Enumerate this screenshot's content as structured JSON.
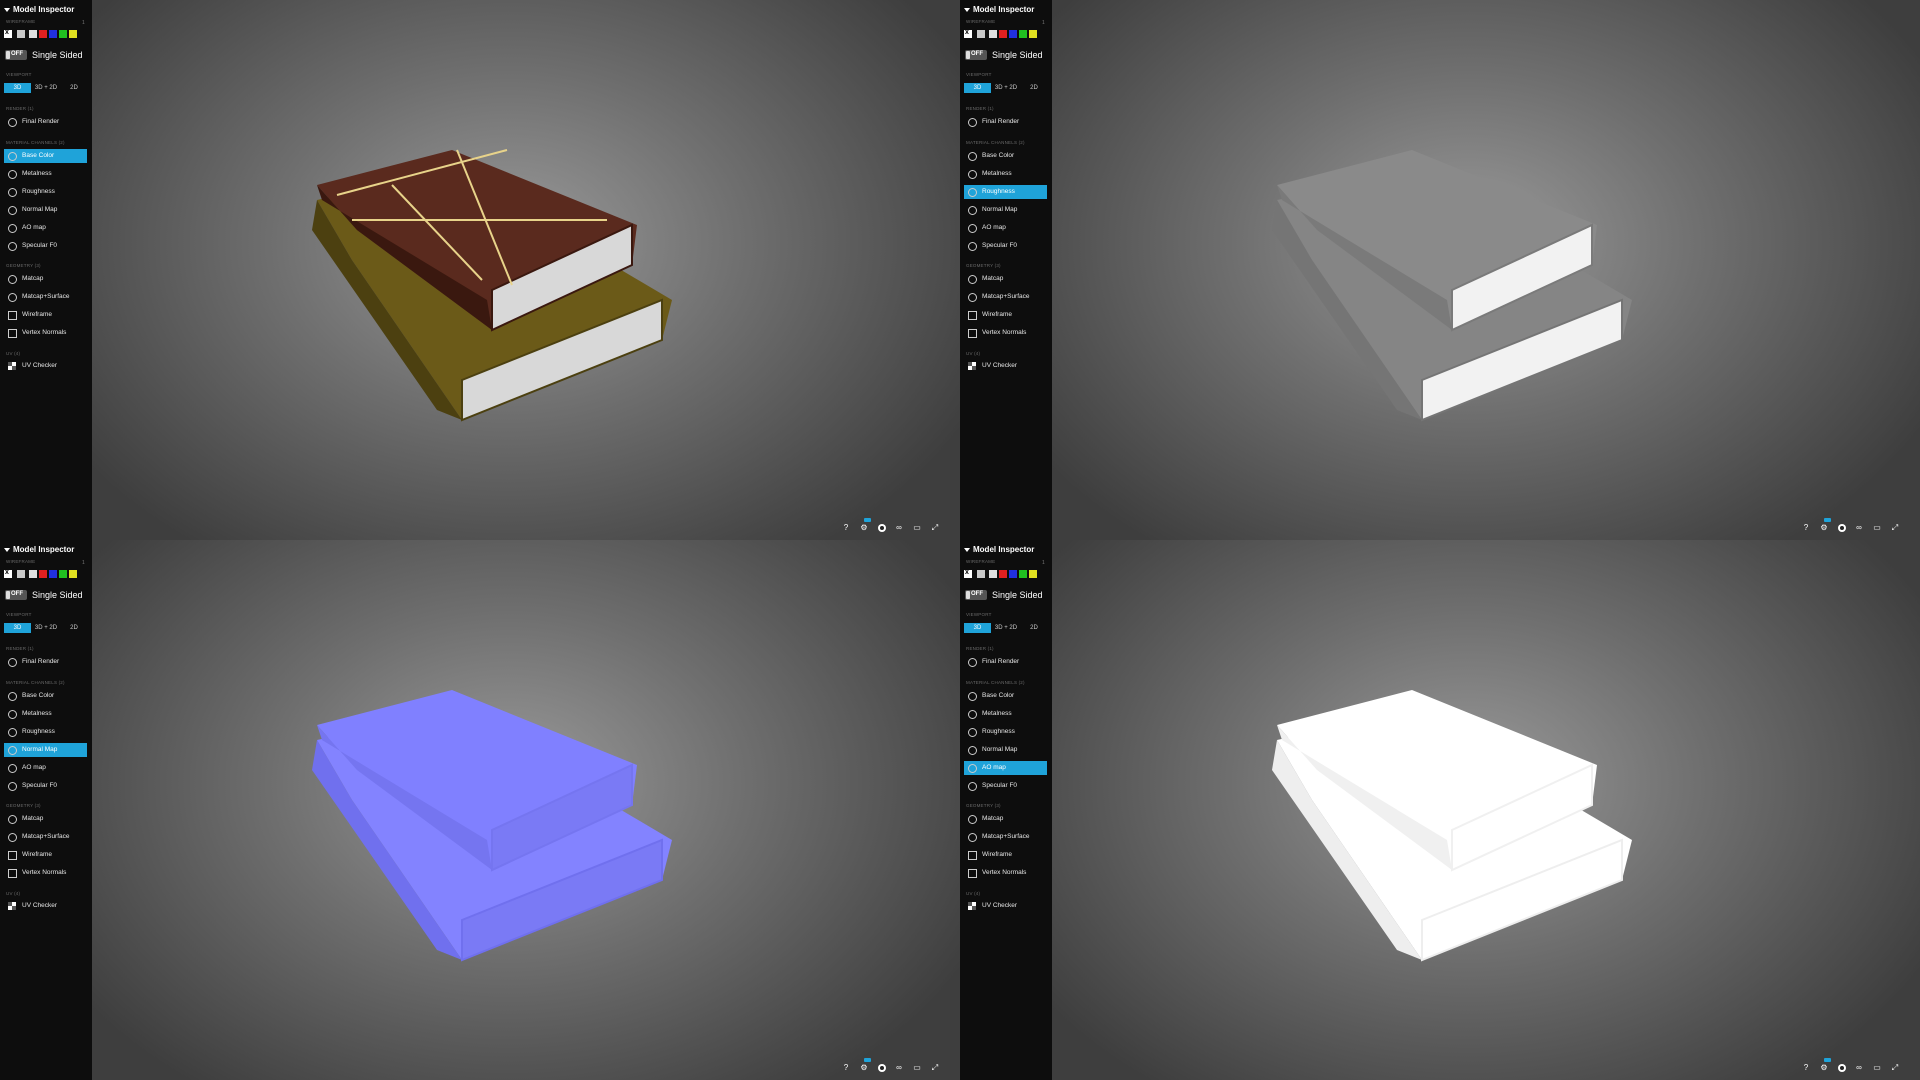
{
  "sidebar": {
    "title": "Model Inspector",
    "wireframe_section": "WIREFRAME",
    "wireframe_value": "1",
    "swatch_colors": [
      "#000000",
      "#c8c8c8",
      "#e0e0e0",
      "#e02020",
      "#2030e0",
      "#20c020",
      "#e0e020"
    ],
    "single_sided_toggle": "OFF",
    "single_sided_label": "Single Sided",
    "viewport_section": "VIEWPORT",
    "viewport_modes": [
      "3D",
      "3D + 2D",
      "2D"
    ],
    "render_section": "RENDER (1)",
    "render_items": [
      {
        "label": "Final Render",
        "icon": "final-render-icon"
      }
    ],
    "material_section": "MATERIAL CHANNELS (2)",
    "material_items": [
      {
        "label": "Base Color",
        "icon": "base-color-icon"
      },
      {
        "label": "Metalness",
        "icon": "metalness-icon"
      },
      {
        "label": "Roughness",
        "icon": "roughness-icon"
      },
      {
        "label": "Normal Map",
        "icon": "normal-map-icon"
      },
      {
        "label": "AO map",
        "icon": "ao-map-icon"
      },
      {
        "label": "Specular F0",
        "icon": "specular-icon"
      }
    ],
    "geometry_section": "GEOMETRY (3)",
    "geometry_items": [
      {
        "label": "Matcap",
        "icon": "matcap-icon"
      },
      {
        "label": "Matcap+Surface",
        "icon": "matcap-surface-icon"
      },
      {
        "label": "Wireframe",
        "icon": "wireframe-icon"
      },
      {
        "label": "Vertex Normals",
        "icon": "vertex-normals-icon"
      }
    ],
    "uv_section": "UV (4)",
    "uv_items": [
      {
        "label": "UV Checker",
        "icon": "uv-checker-icon"
      }
    ]
  },
  "accent_color": "#1fa3d9",
  "panels": [
    {
      "active_item": "Base Color",
      "render_style": "base-color"
    },
    {
      "active_item": "Roughness",
      "render_style": "roughness"
    },
    {
      "active_item": "Normal Map",
      "render_style": "normal-map"
    },
    {
      "active_item": "AO map",
      "render_style": "ao-map"
    }
  ],
  "toolbar_icons": [
    "help-icon",
    "settings-icon",
    "material-icon",
    "vr-icon",
    "hd-icon",
    "fullscreen-icon"
  ],
  "toolbar_labels": {
    "help": "?",
    "fullscreen": "⤢"
  }
}
